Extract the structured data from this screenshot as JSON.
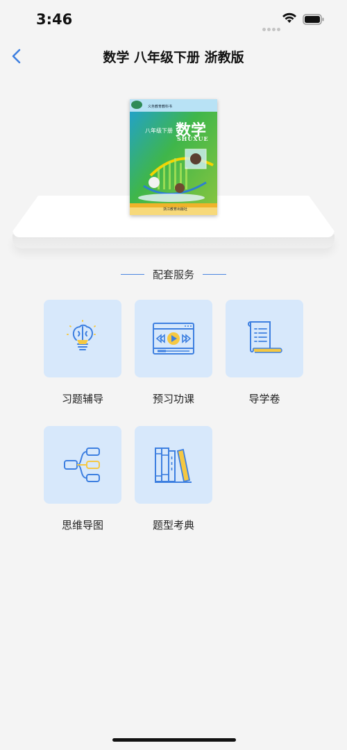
{
  "status_bar": {
    "time": "3:46"
  },
  "nav": {
    "title": "数学 八年级下册 浙教版"
  },
  "book": {
    "cover_grade": "八年级下册",
    "cover_title": "数学",
    "cover_pinyin": "SHUXUE",
    "cover_top_line": "义务教育教科书",
    "cover_publisher": "浙江教育出版社"
  },
  "section": {
    "title": "配套服务"
  },
  "services": [
    {
      "label": "习题辅导",
      "icon": "lightbulb-brain-icon"
    },
    {
      "label": "预习功课",
      "icon": "video-player-icon"
    },
    {
      "label": "导学卷",
      "icon": "scroll-document-icon"
    },
    {
      "label": "思维导图",
      "icon": "mind-map-icon"
    },
    {
      "label": "题型考典",
      "icon": "books-icon"
    }
  ],
  "colors": {
    "accent": "#4a85e0",
    "tile_bg": "#d7e8fb",
    "icon_yellow": "#f5c842",
    "background": "#f4f4f4"
  }
}
